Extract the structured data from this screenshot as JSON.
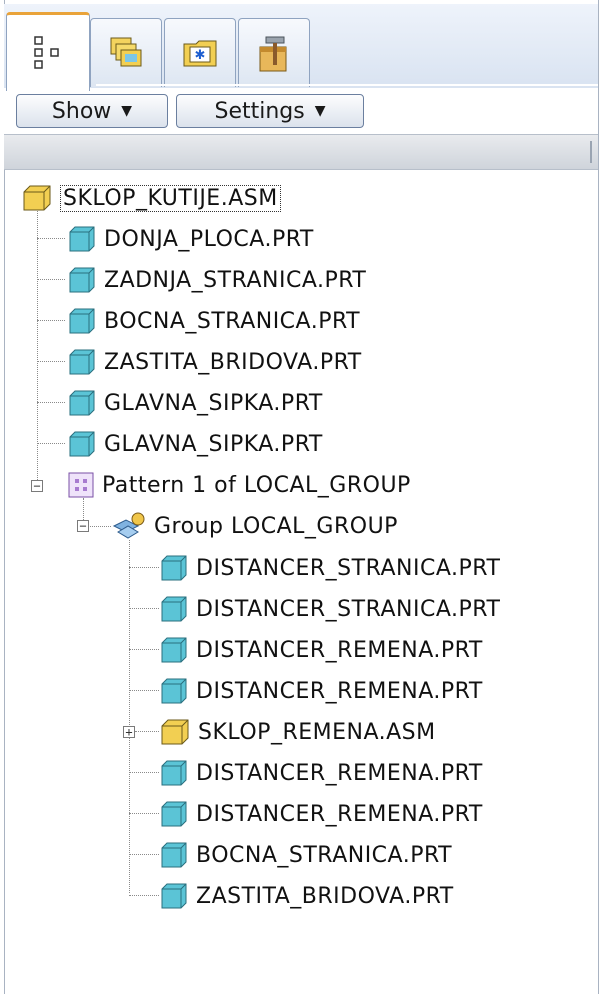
{
  "tabs": [
    {
      "name": "model-tree",
      "icon": "model-tree-icon"
    },
    {
      "name": "layers",
      "icon": "layers-icon"
    },
    {
      "name": "favorites",
      "icon": "favorites-folder-icon"
    },
    {
      "name": "tools",
      "icon": "tools-hammer-icon"
    }
  ],
  "toolbar": {
    "show_label": "Show",
    "settings_label": "Settings"
  },
  "tree": {
    "root": "SKLOP_KUTIJE.ASM",
    "items": [
      "DONJA_PLOCA.PRT",
      "ZADNJA_STRANICA.PRT",
      "BOCNA_STRANICA.PRT",
      "ZASTITA_BRIDOVA.PRT",
      "GLAVNA_SIPKA.PRT",
      "GLAVNA_SIPKA.PRT"
    ],
    "pattern": "Pattern 1 of LOCAL_GROUP",
    "group": "Group LOCAL_GROUP",
    "group_items": [
      "DISTANCER_STRANICA.PRT",
      "DISTANCER_STRANICA.PRT",
      "DISTANCER_REMENA.PRT",
      "DISTANCER_REMENA.PRT",
      "SKLOP_REMENA.ASM",
      "DISTANCER_REMENA.PRT",
      "DISTANCER_REMENA.PRT",
      "BOCNA_STRANICA.PRT",
      "ZASTITA_BRIDOVA.PRT"
    ]
  },
  "colors": {
    "part_icon": "#5bc4d6",
    "assembly_icon": "#f2cf52",
    "pattern_icon": "#a87bd0",
    "tab_accent": "#e9a33a"
  }
}
